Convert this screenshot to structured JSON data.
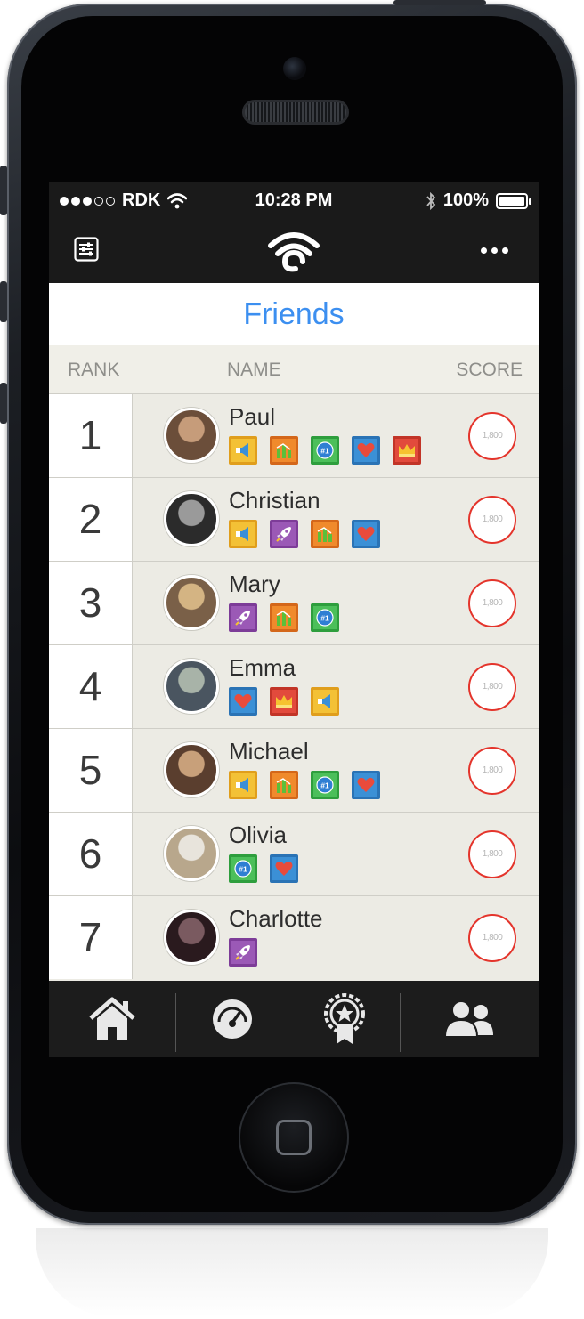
{
  "status_bar": {
    "carrier": "RDK",
    "time": "10:28 PM",
    "battery_pct": "100%",
    "signal_bars_filled": 3,
    "signal_bars_total": 5
  },
  "nav": {
    "settings_icon": "sliders-icon",
    "logo_icon": "wifi-logo-icon",
    "more_icon": "more-dots-icon"
  },
  "page_title": "Friends",
  "columns": {
    "rank": "RANK",
    "name": "NAME",
    "score": "SCORE"
  },
  "colors": {
    "accent": "#3c8ff0",
    "score_ring": "#e4342b",
    "row_bg": "#ecebe4",
    "bar_bg": "#1a1a1a"
  },
  "leaderboard": [
    {
      "rank": "1",
      "name": "Paul",
      "score": "1,800",
      "badges": [
        "megaphone",
        "chart",
        "number-one",
        "heart",
        "crown"
      ]
    },
    {
      "rank": "2",
      "name": "Christian",
      "score": "1,800",
      "badges": [
        "megaphone",
        "rocket",
        "chart",
        "heart"
      ]
    },
    {
      "rank": "3",
      "name": "Mary",
      "score": "1,800",
      "badges": [
        "rocket",
        "chart",
        "number-one"
      ]
    },
    {
      "rank": "4",
      "name": "Emma",
      "score": "1,800",
      "badges": [
        "heart",
        "crown",
        "megaphone"
      ]
    },
    {
      "rank": "5",
      "name": "Michael",
      "score": "1,800",
      "badges": [
        "megaphone",
        "chart",
        "number-one",
        "heart"
      ]
    },
    {
      "rank": "6",
      "name": "Olivia",
      "score": "1,800",
      "badges": [
        "number-one",
        "heart"
      ]
    },
    {
      "rank": "7",
      "name": "Charlotte",
      "score": "1,800",
      "badges": [
        "rocket"
      ]
    }
  ],
  "badge_label_number_one": "#1",
  "tabs": [
    {
      "icon": "home-icon"
    },
    {
      "icon": "speedometer-icon"
    },
    {
      "icon": "award-badge-icon"
    },
    {
      "icon": "friends-icon"
    }
  ]
}
